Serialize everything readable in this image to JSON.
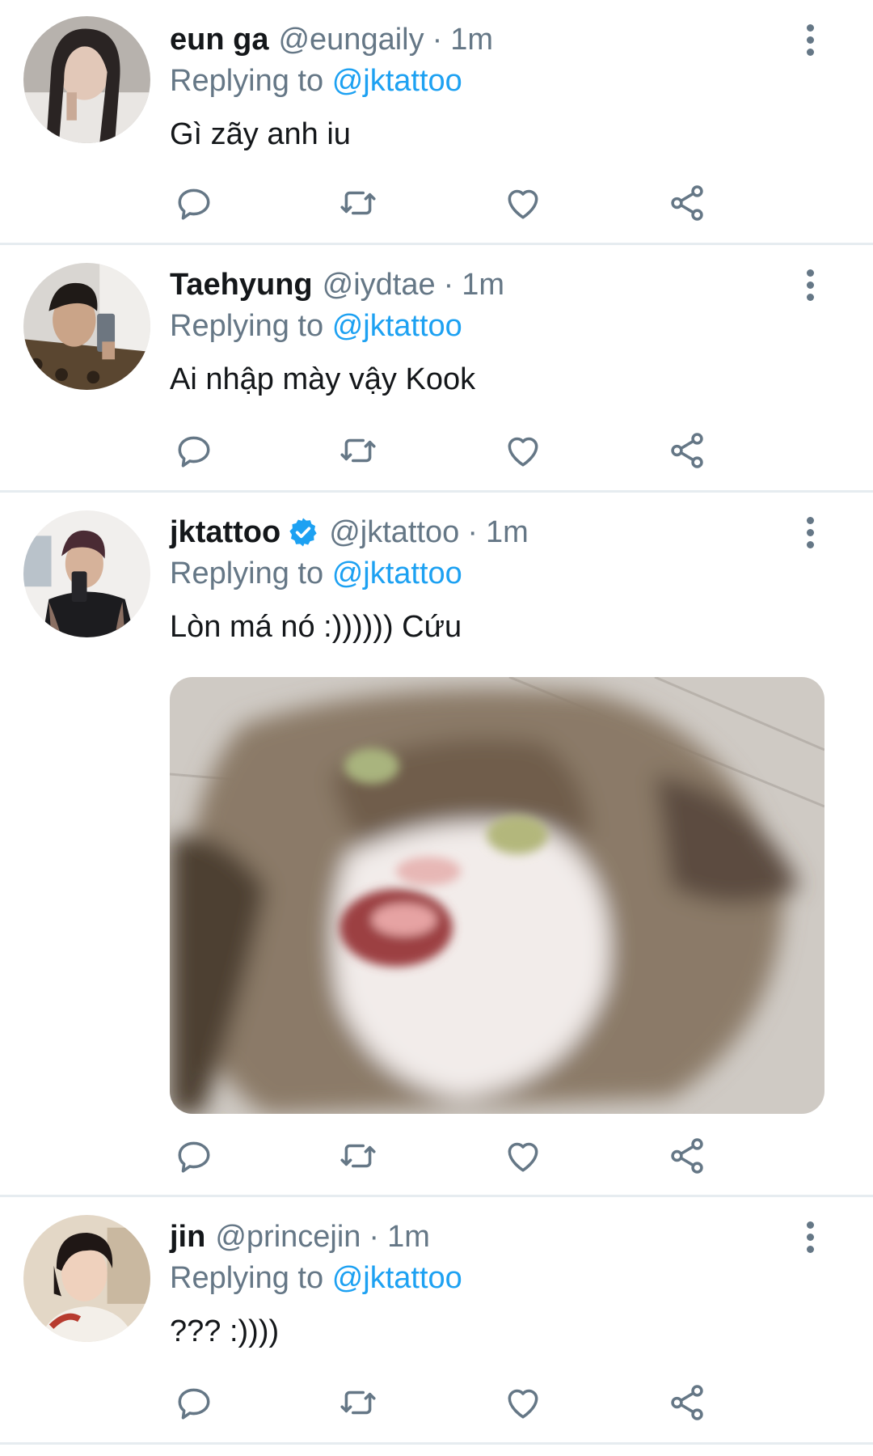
{
  "tweets": [
    {
      "name": "eun ga",
      "handle": "@eungaily",
      "separator": "·",
      "time": "1m",
      "replying_prefix": "Replying to",
      "replying_to": "@jktattoo",
      "text": "Gì zãy anh iu",
      "verified": false
    },
    {
      "name": "Taehyung",
      "handle": "@iydtae",
      "separator": "·",
      "time": "1m",
      "replying_prefix": "Replying to",
      "replying_to": "@jktattoo",
      "text": "Ai nhập mày vậy Kook",
      "verified": false
    },
    {
      "name": "jktattoo",
      "handle": "@jktattoo",
      "separator": "·",
      "time": "1m",
      "replying_prefix": "Replying to",
      "replying_to": "@jktattoo",
      "text": "Lòn má nó :)))))) Cứu",
      "verified": true,
      "has_media": true
    },
    {
      "name": "jin",
      "handle": "@princejin",
      "separator": "·",
      "time": "1m",
      "replying_prefix": "Replying to",
      "replying_to": "@jktattoo",
      "text": "??? :))))",
      "verified": false
    }
  ],
  "icons": {
    "reply": "reply-icon",
    "retweet": "retweet-icon",
    "like": "heart-icon",
    "share": "share-icon",
    "more": "more-vertical-icon",
    "verified": "verified-badge-icon"
  },
  "colors": {
    "link": "#1da1f2",
    "secondary_text": "#657786",
    "primary_text": "#14171a",
    "divider": "#e6ecf0",
    "verified": "#1da1f2"
  }
}
